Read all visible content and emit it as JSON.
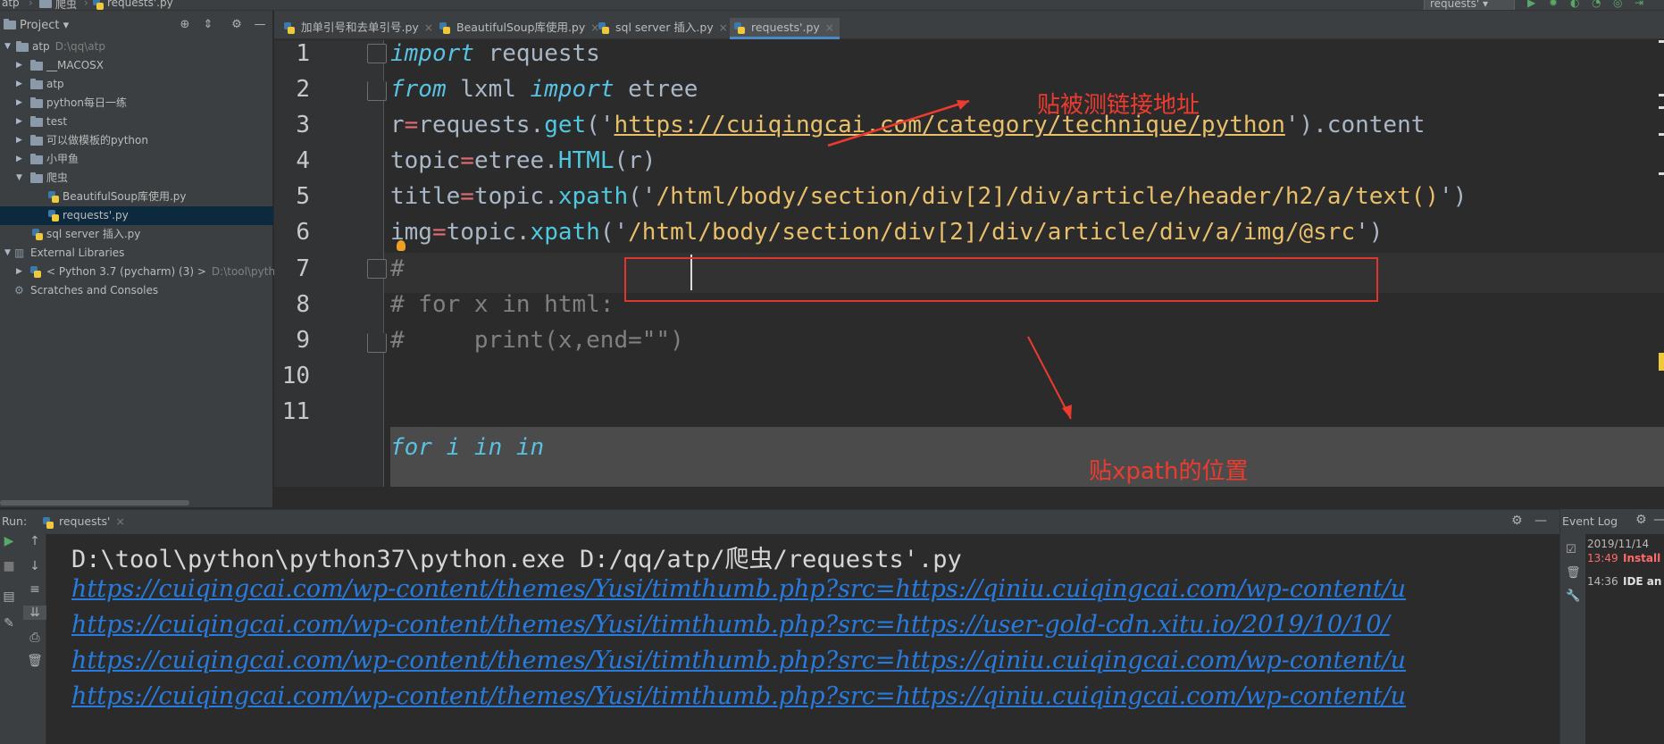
{
  "topbar": {
    "breadcrumb": [
      "atp",
      "爬虫",
      "requests'.py"
    ],
    "run_config": "requests'"
  },
  "project_panel": {
    "title": "Project",
    "tree": [
      {
        "label": "atp",
        "path": "D:\\qq\\atp",
        "type": "folder",
        "expanded": true
      },
      {
        "label": "__MACOSX",
        "type": "folder"
      },
      {
        "label": "atp",
        "type": "folder"
      },
      {
        "label": "python每日一练",
        "type": "folder"
      },
      {
        "label": "test",
        "type": "folder"
      },
      {
        "label": "可以做模板的python",
        "type": "folder"
      },
      {
        "label": "小甲鱼",
        "type": "folder"
      },
      {
        "label": "爬虫",
        "type": "folder",
        "expanded": true
      },
      {
        "label": "BeautifulSoup库使用.py",
        "type": "file"
      },
      {
        "label": "requests'.py",
        "type": "file",
        "selected": true
      },
      {
        "label": "sql server 插入.py",
        "type": "file"
      },
      {
        "label": "External Libraries",
        "type": "lib"
      },
      {
        "label": "< Python 3.7 (pycharm) (3) >",
        "path": "D:\\tool\\python",
        "type": "python"
      },
      {
        "label": "Scratches and Consoles",
        "type": "scratch"
      }
    ]
  },
  "tabs": [
    {
      "label": "加单引号和去单引号.py"
    },
    {
      "label": "BeautifulSoup库使用.py"
    },
    {
      "label": "sql server 插入.py"
    },
    {
      "label": "requests'.py",
      "active": true
    }
  ],
  "editor": {
    "line_numbers": [
      "1",
      "2",
      "3",
      "4",
      "5",
      "6",
      "7",
      "8",
      "9",
      "10",
      "11"
    ],
    "l1": {
      "kw": "import",
      "rest": " requests"
    },
    "l2": {
      "kw1": "from",
      "mid": " lxml ",
      "kw2": "import",
      "rest": " etree"
    },
    "l3": {
      "a": "r",
      "eq": "=",
      "b": "requests.",
      "fn": "get",
      "p1": "('",
      "url": "https://cuiqingcai.com/category/technique/python",
      "p2": "').content"
    },
    "l4": {
      "a": "topic",
      "eq": "=",
      "b": "etree.",
      "fn": "HTML",
      "c": "(r)"
    },
    "l5": {
      "a": "title",
      "eq": "=",
      "b": "topic.",
      "fn": "xpath",
      "p1": "('",
      "str": "/html/body/section/div[2]/div/article/header/h2/a/text()",
      "p2": "')"
    },
    "l6": {
      "a": "img",
      "eq": "=",
      "b": "topic.",
      "fn": "xpath",
      "p1": "('",
      "str": "/html/body/section/div[2]/div/article/div/a/img/@src",
      "p2": "')"
    },
    "l7": "#",
    "l8": "# for x in html:",
    "l9": "#     print(x,end=\"\")",
    "l11": "for i in in"
  },
  "annotations": {
    "link_note": "贴被测链接地址",
    "xpath_note": "贴xpath的位置"
  },
  "run_panel": {
    "label": "Run:",
    "tab": "requests'",
    "lines": [
      "D:\\tool\\python\\python37\\python.exe D:/qq/atp/爬虫/requests'.py",
      "https://cuiqingcai.com/wp-content/themes/Yusi/timthumb.php?src=https://qiniu.cuiqingcai.com/wp-content/u",
      "https://cuiqingcai.com/wp-content/themes/Yusi/timthumb.php?src=https://user-gold-cdn.xitu.io/2019/10/10/",
      "https://cuiqingcai.com/wp-content/themes/Yusi/timthumb.php?src=https://qiniu.cuiqingcai.com/wp-content/u",
      "https://cuiqingcai.com/wp-content/themes/Yusi/timthumb.php?src=https://qiniu.cuiqingcai.com/wp-content/u"
    ]
  },
  "event_log": {
    "title": "Event Log",
    "date": "2019/11/14",
    "entries": [
      {
        "time": "13:49",
        "text": "Install",
        "color": "#ff6b68"
      },
      {
        "time": "14:36",
        "text": "IDE an",
        "color": "#e0e0e0"
      }
    ]
  },
  "colors": {
    "accent": "#4a88c7",
    "annotation": "#ee3b2f",
    "link": "#287bde"
  }
}
